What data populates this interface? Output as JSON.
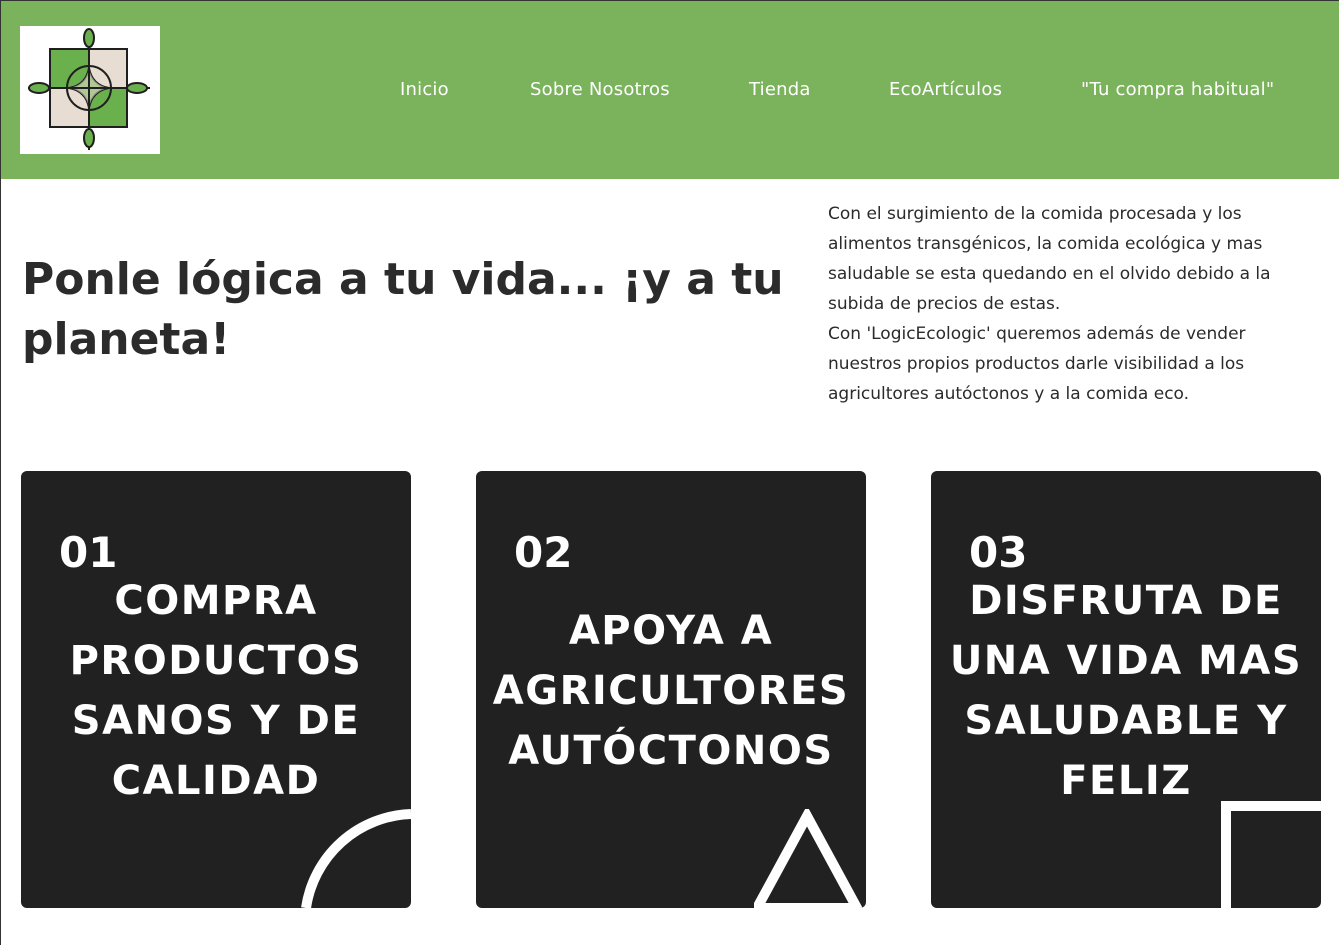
{
  "header": {
    "background_color": "#7ab35b",
    "logo": {
      "name": "logic-ecologic-logo",
      "colors": [
        "#6ab04c",
        "#e7ddd2",
        "#1f1f1f"
      ]
    },
    "nav": [
      {
        "label": "Inicio"
      },
      {
        "label": "Sobre Nosotros"
      },
      {
        "label": "Tienda"
      },
      {
        "label": "EcoArtículos"
      },
      {
        "label": "\"Tu compra habitual\""
      }
    ]
  },
  "hero": {
    "headline": "Ponle lógica a tu vida... ¡y a tu planeta!",
    "paragraph_1": "Con el surgimiento de la comida procesada y los alimentos transgénicos, la comida ecológica y mas saludable se esta quedando en el olvido debido a la subida de precios de estas.",
    "paragraph_2": "Con 'LogicEcologic' queremos además de vender nuestros propios productos darle visibilidad a los agricultores autóctonos y a la comida eco."
  },
  "cards": [
    {
      "number": "01",
      "title": "COMPRA PRODUCTOS SANOS Y DE CALIDAD",
      "shape": "quarter-circle-icon"
    },
    {
      "number": "02",
      "title": "APOYA A AGRICULTORES AUTÓCTONOS",
      "shape": "triangle-icon"
    },
    {
      "number": "03",
      "title": "DISFRUTA DE UNA VIDA MAS SALUDABLE Y FELIZ",
      "shape": "square-icon"
    }
  ],
  "colors": {
    "card_background": "#212121",
    "text_dark": "#2b2b2b",
    "white": "#ffffff"
  }
}
